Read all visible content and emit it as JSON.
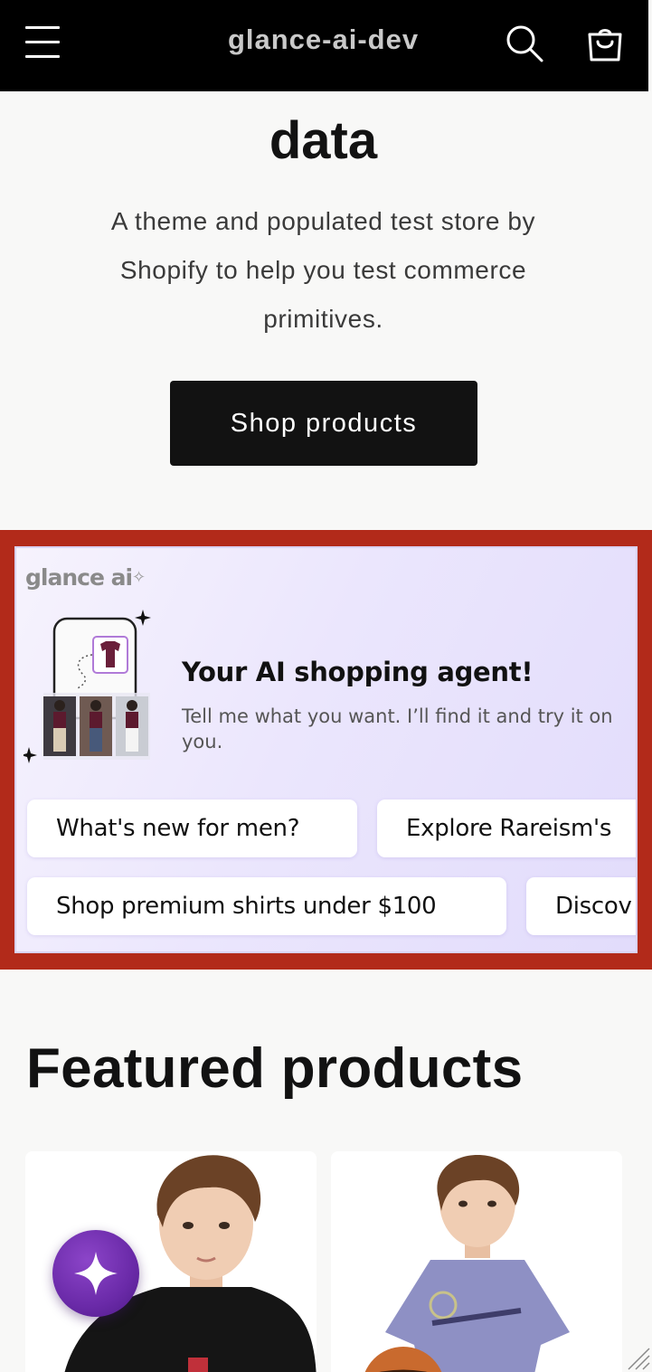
{
  "header": {
    "store_name": "glance-ai-dev",
    "menu_icon": "hamburger-menu-icon",
    "search_icon": "search-icon",
    "cart_icon": "cart-bag-icon"
  },
  "hero": {
    "title": "data",
    "description": "A theme and populated test store by Shopify to help you test commerce primitives.",
    "button_label": "Shop products"
  },
  "glance_widget": {
    "brand": "glance ai",
    "title": "Your AI shopping agent!",
    "subtitle": "Tell me what you want. I’ll find it and try it on you.",
    "chips": [
      "What's new for men?",
      "Explore Rareism's",
      "Shop premium shirts under $100",
      "Discov"
    ],
    "frame_color": "#b22a1a",
    "accent_color": "#7b3fbf"
  },
  "featured": {
    "title": "Featured products"
  },
  "floating_button": {
    "icon": "sparkle-icon"
  }
}
